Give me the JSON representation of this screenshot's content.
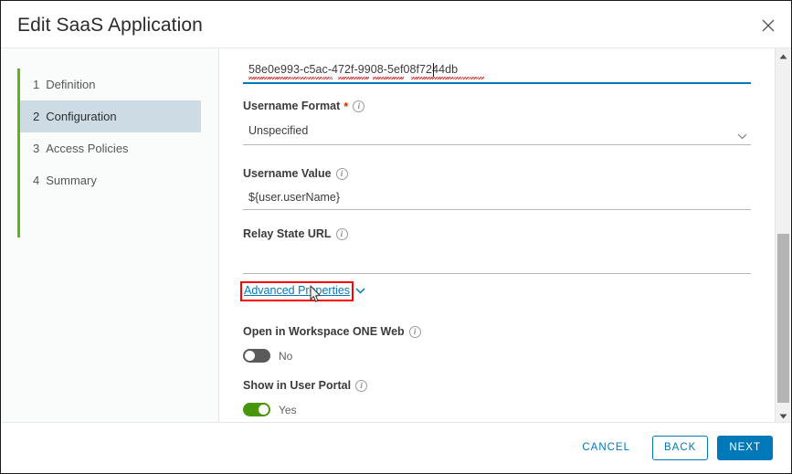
{
  "header": {
    "title": "Edit SaaS Application",
    "close_icon": "close-icon"
  },
  "sidebar": {
    "items": [
      {
        "num": "1",
        "label": "Definition",
        "active": false
      },
      {
        "num": "2",
        "label": "Configuration",
        "active": true
      },
      {
        "num": "3",
        "label": "Access Policies",
        "active": false
      },
      {
        "num": "4",
        "label": "Summary",
        "active": false
      }
    ]
  },
  "form": {
    "top_field": {
      "value": "58e0e993-c5ac-472f-9908-5ef08f7244db",
      "focused": true
    },
    "username_format": {
      "label": "Username Format",
      "required_marker": "*",
      "info_icon": "info-icon",
      "value": "Unspecified",
      "chevron_icon": "chevron-down-icon"
    },
    "username_value": {
      "label": "Username Value",
      "info_icon": "info-icon",
      "value": "${user.userName}"
    },
    "relay_state_url": {
      "label": "Relay State URL",
      "info_icon": "info-icon",
      "value": "",
      "placeholder": ""
    },
    "advanced_properties": {
      "label": "Advanced Properties",
      "chevron_icon": "chevron-down-icon",
      "highlight_color": "#ff0000",
      "link_color": "#0079b8"
    },
    "open_in_web": {
      "label": "Open in Workspace ONE Web",
      "info_icon": "info-icon",
      "state": "off",
      "state_label": "No"
    },
    "show_in_portal": {
      "label": "Show in User Portal",
      "info_icon": "info-icon",
      "state": "on",
      "state_label": "Yes"
    }
  },
  "scrollbar": {
    "up_icon": "scroll-up-arrow-icon",
    "down_icon": "scroll-down-arrow-icon"
  },
  "footer": {
    "cancel_label": "CANCEL",
    "back_label": "BACK",
    "next_label": "NEXT"
  },
  "colors": {
    "accent": "#0079b8",
    "active_nav": "#ccdbe4",
    "rail_green": "#60b515",
    "toggle_on": "#48960c",
    "required": "#e62700",
    "highlight": "#ff0000"
  }
}
